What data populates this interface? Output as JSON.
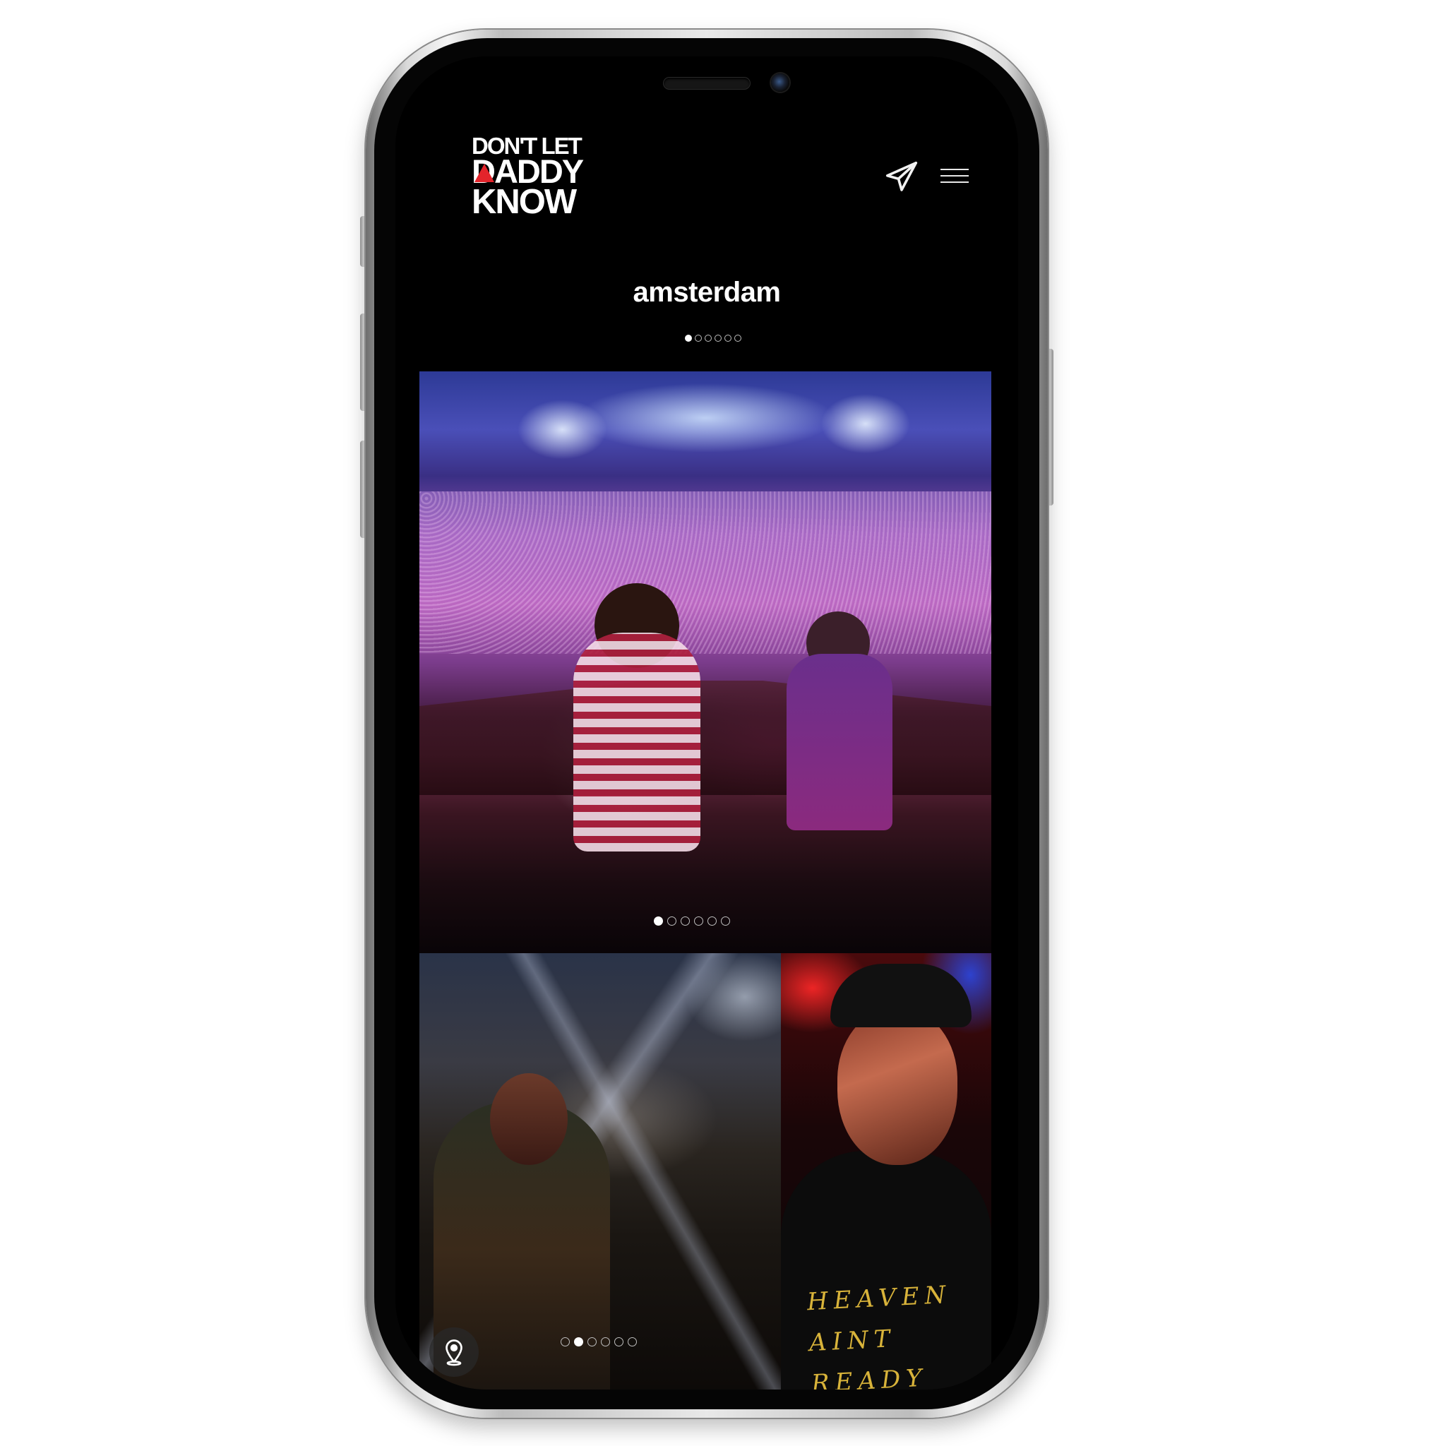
{
  "brand": {
    "logo_line1": "DON'T LET",
    "logo_line2": "DADDY",
    "logo_line3": "KNOW",
    "accent_color": "#e3242b"
  },
  "header": {
    "send_icon": "paper-plane-icon",
    "menu_icon": "hamburger-menu-icon"
  },
  "page": {
    "title": "amsterdam",
    "section_pager": {
      "count": 6,
      "active": 0
    }
  },
  "gallery": {
    "slide1_pager": {
      "count": 6,
      "active": 0
    },
    "slide2_pager": {
      "count": 6,
      "active": 1
    },
    "shirt_text": "HEAVEN AINT READY"
  },
  "location_button": {
    "icon": "map-pin-icon"
  }
}
